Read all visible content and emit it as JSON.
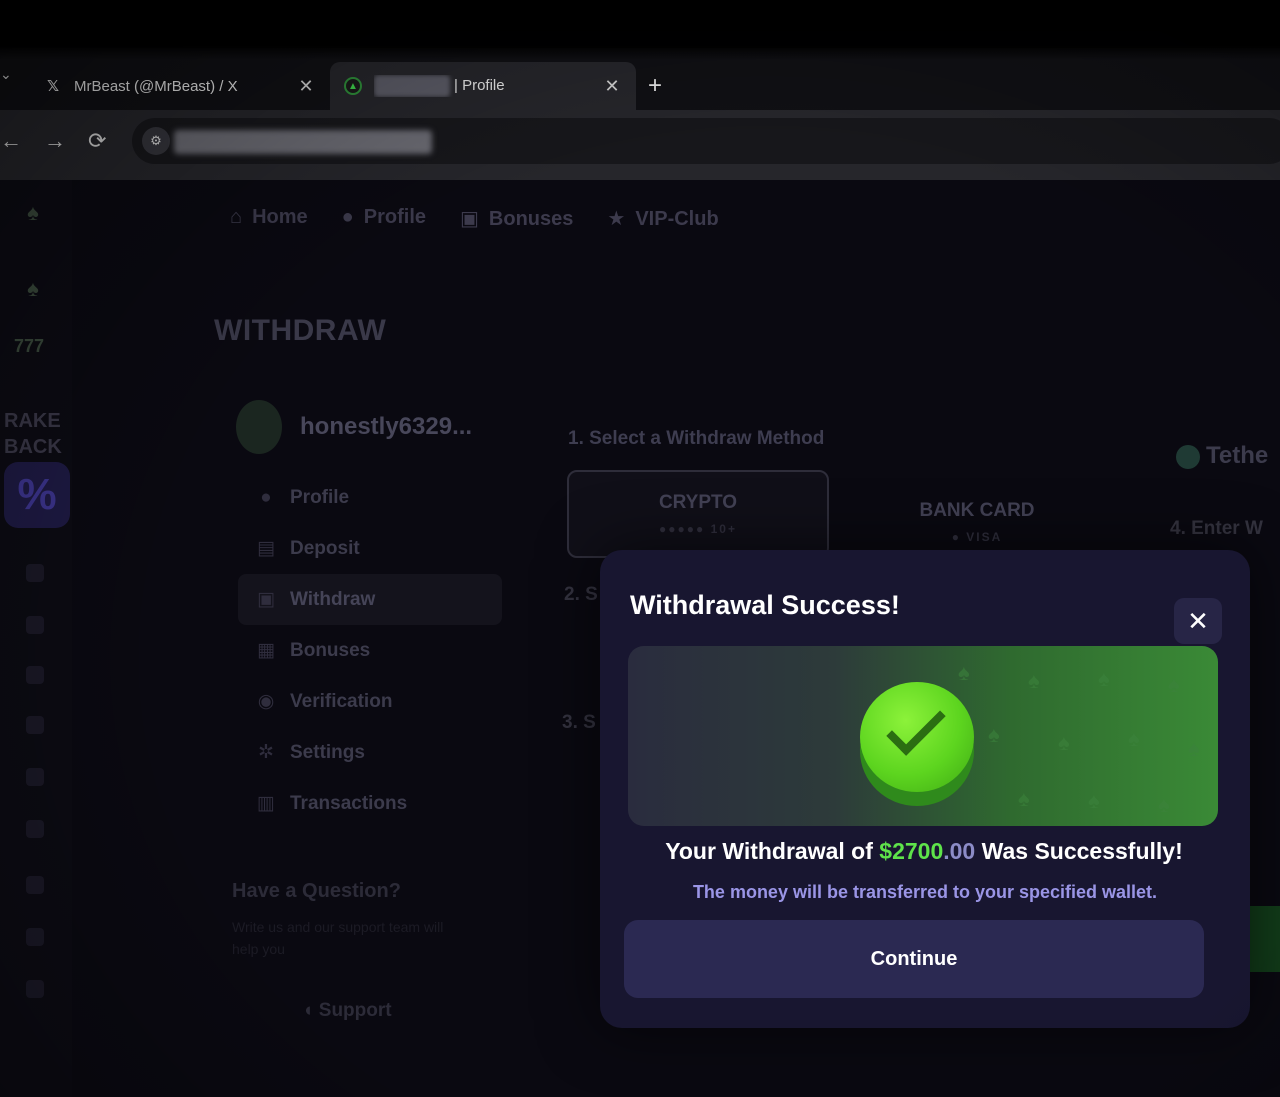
{
  "browser": {
    "tabs": [
      {
        "title": "MrBeast (@MrBeast) / X",
        "icon": "x-logo-icon",
        "close": "✕"
      },
      {
        "title": "| Profile",
        "icon": "site-flame-icon",
        "close": "✕"
      }
    ],
    "new_tab_label": "+",
    "back_label": "←",
    "forward_label": "→",
    "reload_label": "⟳"
  },
  "site": {
    "topnav": [
      {
        "label": "Home",
        "icon": "home-icon"
      },
      {
        "label": "Profile",
        "icon": "user-icon"
      },
      {
        "label": "Bonuses",
        "icon": "gift-icon"
      },
      {
        "label": "VIP-Club",
        "icon": "star-icon"
      }
    ],
    "rail": {
      "rakeback_line1": "RAKE",
      "rakeback_line2": "BACK",
      "rakeback_badge": "%",
      "icon_777": "777"
    },
    "page_title": "WITHDRAW",
    "username": "honestly6329...",
    "side_menu": [
      {
        "label": "Profile",
        "icon": "user-icon"
      },
      {
        "label": "Deposit",
        "icon": "wallet-icon"
      },
      {
        "label": "Withdraw",
        "icon": "lock-icon"
      },
      {
        "label": "Bonuses",
        "icon": "gift-icon"
      },
      {
        "label": "Verification",
        "icon": "shield-icon"
      },
      {
        "label": "Settings",
        "icon": "gear-icon"
      },
      {
        "label": "Transactions",
        "icon": "list-icon"
      }
    ],
    "help": {
      "title": "Have a Question?",
      "subtitle": "Write us and our support team will help you",
      "support_label": "Support"
    },
    "withdraw_form": {
      "step1": "1. Select a Withdraw Method",
      "methods": [
        {
          "label": "CRYPTO",
          "sub": "10+"
        },
        {
          "label": "BANK CARD",
          "sub": "VISA"
        }
      ],
      "step2_partial": "2. S",
      "step3_partial": "3. S",
      "currency_partial": "Tethe",
      "step4_partial": "4. Enter W"
    }
  },
  "modal": {
    "title": "Withdrawal Success!",
    "close_label": "✕",
    "message_prefix": "Your Withdrawal of ",
    "amount_main": "$2700",
    "amount_cents": ".00",
    "message_suffix": " Was Successfully!",
    "submessage": "The money will be transferred to your specified wallet.",
    "continue_label": "Continue"
  },
  "colors": {
    "accent_green": "#5ee34a",
    "modal_bg": "#181630",
    "cents_purple": "#8c8cc7"
  }
}
